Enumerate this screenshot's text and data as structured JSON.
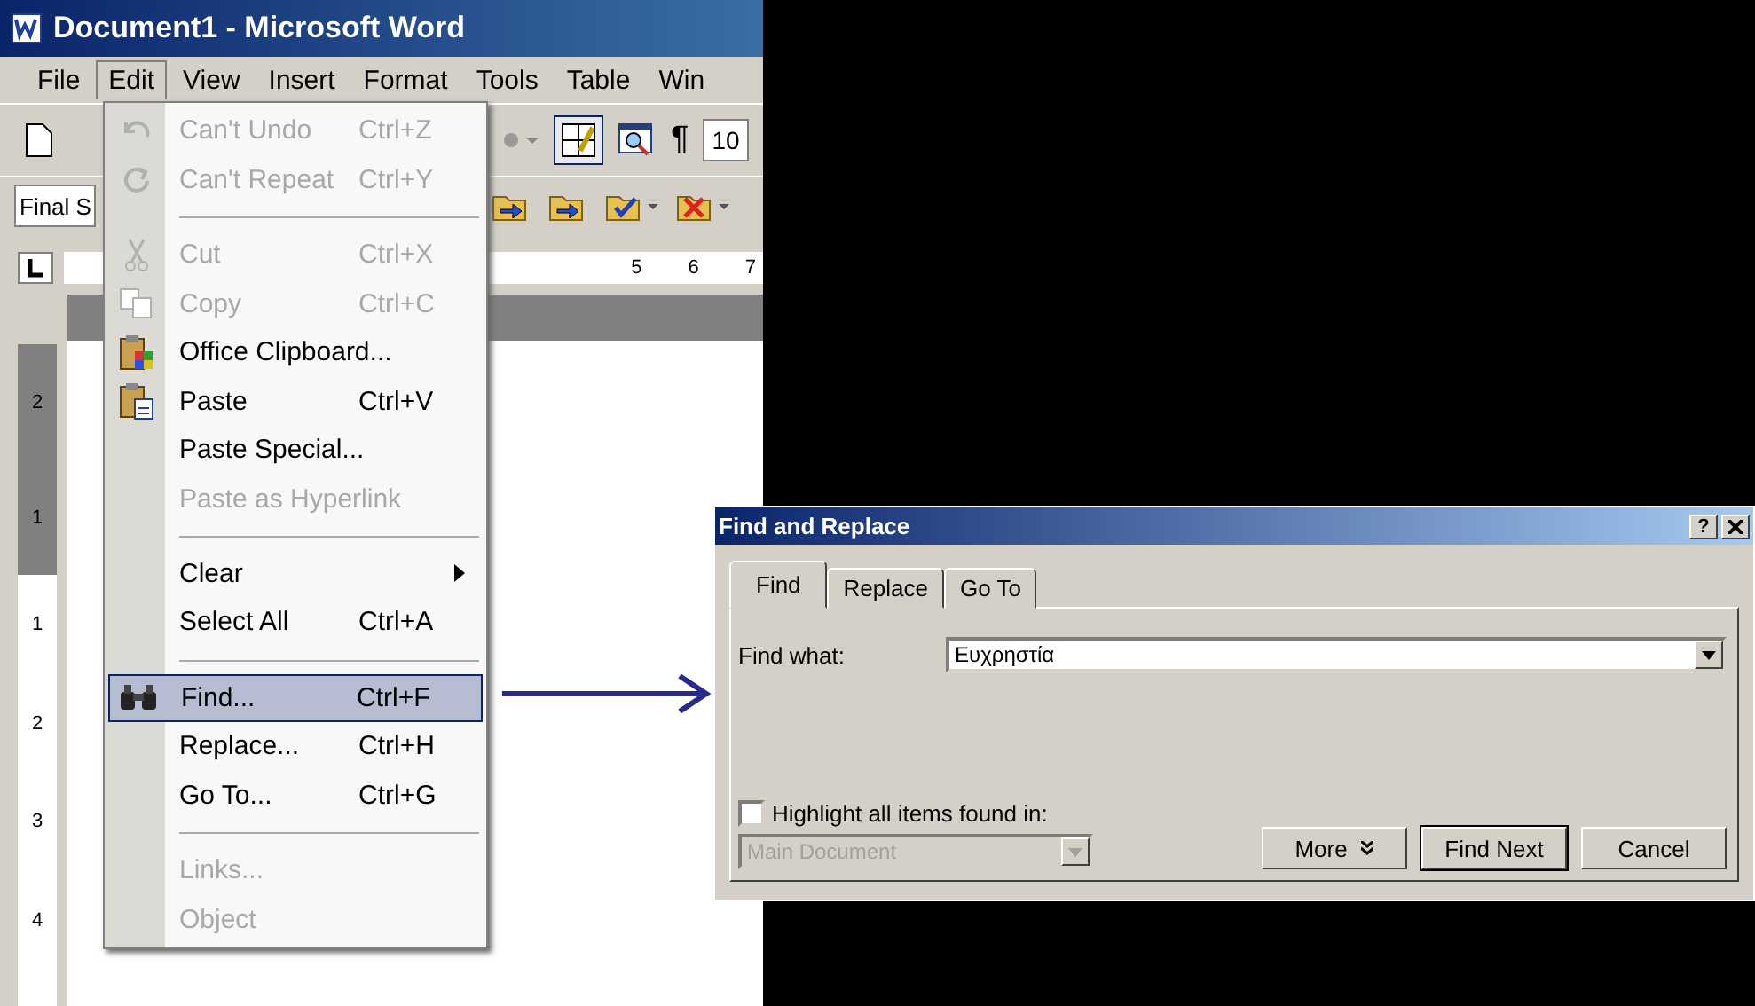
{
  "window": {
    "title": "Document1 - Microsoft Word"
  },
  "menu_bar": [
    {
      "label": "File",
      "selected": false
    },
    {
      "label": "Edit",
      "selected": true
    },
    {
      "label": "View",
      "selected": false
    },
    {
      "label": "Insert",
      "selected": false
    },
    {
      "label": "Format",
      "selected": false
    },
    {
      "label": "Tools",
      "selected": false
    },
    {
      "label": "Table",
      "selected": false
    },
    {
      "label": "Win",
      "selected": false
    }
  ],
  "toolbar": {
    "paragraph_mark": "¶",
    "font_size": "10",
    "style": "Final S"
  },
  "ruler": {
    "labels": [
      "5",
      "6",
      "7"
    ]
  },
  "vertical_ruler": {
    "labels": [
      "2",
      "1",
      "1",
      "2",
      "3",
      "4"
    ]
  },
  "edit_menu": {
    "sections": [
      [
        {
          "kind": "undo",
          "label": "Can't Undo",
          "shortcut": "Ctrl+Z",
          "disabled": true,
          "selected": false
        },
        {
          "kind": "repeat",
          "label": "Can't Repeat",
          "shortcut": "Ctrl+Y",
          "disabled": true,
          "selected": false
        }
      ],
      [
        {
          "kind": "cut",
          "label": "Cut",
          "shortcut": "Ctrl+X",
          "disabled": true,
          "selected": false
        },
        {
          "kind": "copy",
          "label": "Copy",
          "shortcut": "Ctrl+C",
          "disabled": true,
          "selected": false
        },
        {
          "kind": "clipboard",
          "label": "Office Clipboard...",
          "disabled": false,
          "selected": false
        },
        {
          "kind": "paste",
          "label": "Paste",
          "shortcut": "Ctrl+V",
          "disabled": false,
          "selected": false
        },
        {
          "kind": "plain",
          "label": "Paste Special...",
          "disabled": false,
          "selected": false
        },
        {
          "kind": "plain",
          "label": "Paste as Hyperlink",
          "disabled": true,
          "selected": false
        }
      ],
      [
        {
          "kind": "plain",
          "label": "Clear",
          "submenu": true,
          "disabled": false,
          "selected": false
        },
        {
          "kind": "plain",
          "label": "Select All",
          "shortcut": "Ctrl+A",
          "disabled": false,
          "selected": false
        }
      ],
      [
        {
          "kind": "find",
          "label": "Find...",
          "shortcut": "Ctrl+F",
          "disabled": false,
          "selected": true
        },
        {
          "kind": "plain",
          "label": "Replace...",
          "shortcut": "Ctrl+H",
          "disabled": false,
          "selected": false
        },
        {
          "kind": "plain",
          "label": "Go To...",
          "shortcut": "Ctrl+G",
          "disabled": false,
          "selected": false
        }
      ],
      [
        {
          "kind": "plain",
          "label": "Links...",
          "disabled": true,
          "selected": false
        },
        {
          "kind": "plain",
          "label": "Object",
          "disabled": true,
          "selected": false
        }
      ]
    ]
  },
  "dialog": {
    "title": "Find and Replace",
    "help": "?",
    "tabs": [
      {
        "label": "Find",
        "selected": true
      },
      {
        "label": "Replace",
        "selected": false
      },
      {
        "label": "Go To",
        "selected": false
      }
    ],
    "find_what": {
      "label": "Find what:",
      "value": "Ευχρηστία"
    },
    "highlight": {
      "label": "Highlight all items found in:",
      "checked": false
    },
    "search_in": {
      "value": "Main Document",
      "disabled": true
    },
    "buttons": [
      {
        "kind": "more",
        "label": "More",
        "default": false
      },
      {
        "kind": "plain",
        "label": "Find Next",
        "default": true
      },
      {
        "kind": "plain",
        "label": "Cancel",
        "default": false
      }
    ]
  }
}
